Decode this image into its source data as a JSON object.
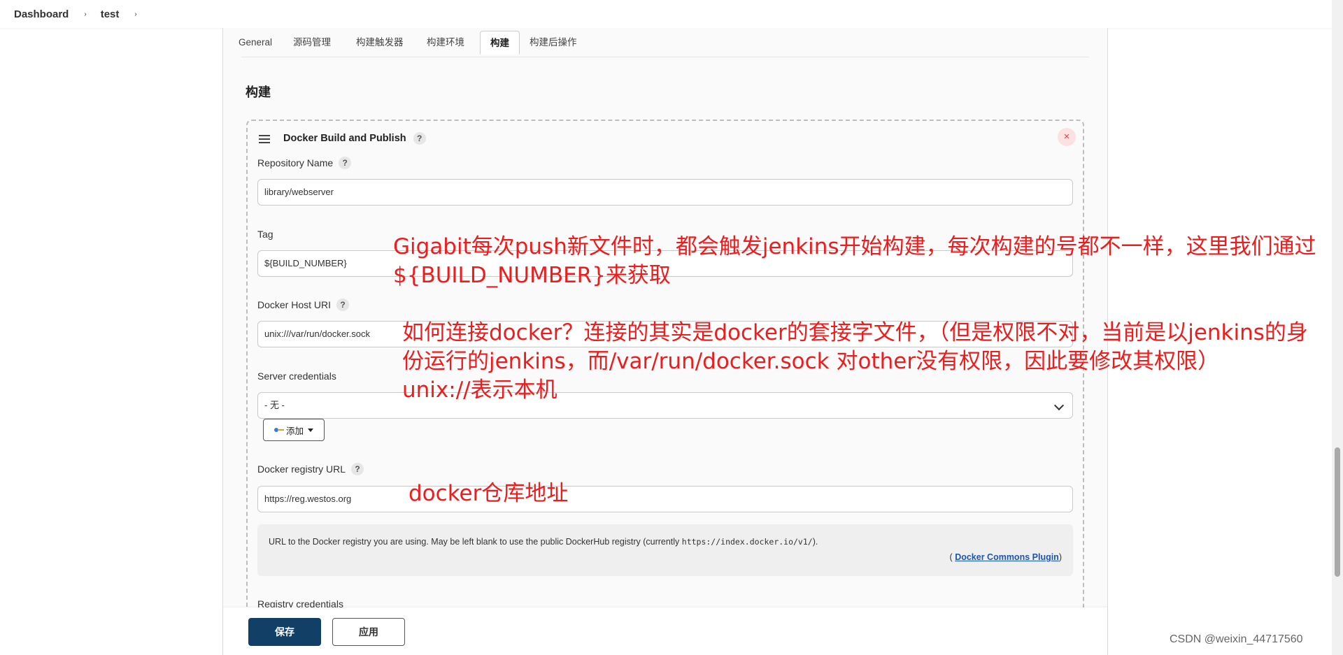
{
  "breadcrumb": {
    "items": [
      "Dashboard",
      "test"
    ],
    "separator": "›"
  },
  "tabs": [
    "General",
    "源码管理",
    "构建触发器",
    "构建环境",
    "构建",
    "构建后操作"
  ],
  "active_tab": "构建",
  "section_title": "构建",
  "step": {
    "title": "Docker Build and Publish",
    "help": "?",
    "close": "×"
  },
  "fields": {
    "repository_name": {
      "label": "Repository Name",
      "value": "library/webserver"
    },
    "tag": {
      "label": "Tag",
      "value": "${BUILD_NUMBER}"
    },
    "docker_host_uri": {
      "label": "Docker Host URI",
      "value": "unix:///var/run/docker.sock"
    },
    "server_credentials": {
      "label": "Server credentials",
      "value": "- 无 -"
    },
    "add_button": "添加",
    "docker_registry_url": {
      "label": "Docker registry URL",
      "value": "https://reg.westos.org"
    },
    "registry_credentials": {
      "label": "Registry credentials"
    }
  },
  "help_box": {
    "text": "URL to the Docker registry you are using. May be left blank to use the public DockerHub registry (currently ",
    "code": "https://index.docker.io/v1/",
    "text_end": ").",
    "source_prefix": "(",
    "source_link": "Docker Commons Plugin",
    "source_suffix": ")"
  },
  "actions": {
    "save": "保存",
    "apply": "应用"
  },
  "annotations": {
    "tag_line1": "Gigabit每次push新文件时，都会触发jenkins开始构建，每次构建的号都不一样，这里我们通过",
    "tag_line2": "${BUILD_NUMBER}来获取",
    "host_line1": "如何连接docker？连接的其实是docker的套接字文件，（但是权限不对，当前是以jenkins的身",
    "host_line2": "份运行的jenkins，而/var/run/docker.sock 对other没有权限，因此要修改其权限）",
    "host_line3": "unix://表示本机",
    "registry": "docker仓库地址"
  },
  "watermark": "CSDN @weixin_44717560",
  "colors": {
    "save_button": "#123f66",
    "annotation": "#ee1c1c",
    "link": "#1a55b4",
    "close": "#d24545"
  }
}
